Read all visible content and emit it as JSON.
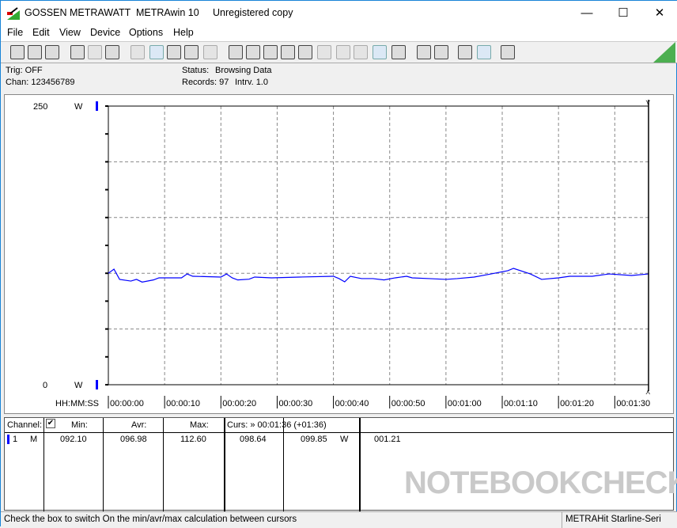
{
  "window": {
    "brand": "GOSSEN METRAWATT",
    "app": "METRAwin 10",
    "license": "Unregistered copy",
    "minimize": "—",
    "maximize": "☐",
    "close": "✕"
  },
  "menu": [
    "File",
    "Edit",
    "View",
    "Device",
    "Options",
    "Help"
  ],
  "toolbar_icons": [
    "save-icon",
    "save-as-icon",
    "open-folder-icon",
    "device-read-icon",
    "device-read-disabled-icon",
    "device-memory-icon",
    "digital-display-icon",
    "waveform-icon",
    "crosshair-icon",
    "table-icon",
    "histogram-icon",
    "transfer-icon",
    "import-icon",
    "data-log-icon",
    "monitor-icon",
    "function-icon",
    "device-icon",
    "signal-icon",
    "wave-icon",
    "trigger-icon",
    "cursor-icon",
    "print-icon",
    "print-preview-icon",
    "zoom-wave-icon",
    "zoom-active-icon",
    "comment-icon"
  ],
  "info": {
    "trig": "Trig: OFF",
    "chan": "Chan:  123456789",
    "status_label": "Status:",
    "status_value": "Browsing Data",
    "records": "Records: 97",
    "interval": "Intrv. 1.0"
  },
  "chart_data": {
    "type": "line",
    "ylim": [
      0,
      250
    ],
    "y_top_label": "250",
    "y_bottom_label": "0",
    "unit": "W",
    "xlabel": "HH:MM:SS",
    "xlim": [
      0,
      96
    ],
    "x_ticks": [
      "00:00:00",
      "00:00:10",
      "00:00:20",
      "00:00:30",
      "00:00:40",
      "00:00:50",
      "00:01:00",
      "00:01:10",
      "00:01:20",
      "00:01:30"
    ],
    "grid": true,
    "color": "#0000ff",
    "points": [
      [
        0,
        100.0
      ],
      [
        1,
        103.7
      ],
      [
        2,
        94.5
      ],
      [
        4,
        93.0
      ],
      [
        5,
        94.5
      ],
      [
        6,
        92.1
      ],
      [
        8,
        94.0
      ],
      [
        9,
        95.9
      ],
      [
        13,
        95.9
      ],
      [
        14,
        99.4
      ],
      [
        15,
        97.3
      ],
      [
        20,
        96.6
      ],
      [
        21,
        99.4
      ],
      [
        22,
        95.9
      ],
      [
        23,
        94.0
      ],
      [
        25,
        94.7
      ],
      [
        26,
        96.6
      ],
      [
        29,
        95.9
      ],
      [
        34,
        96.6
      ],
      [
        40,
        97.3
      ],
      [
        41,
        95.2
      ],
      [
        42,
        92.3
      ],
      [
        43,
        97.3
      ],
      [
        45,
        95.2
      ],
      [
        47,
        95.2
      ],
      [
        49,
        94.0
      ],
      [
        51,
        95.9
      ],
      [
        53,
        97.3
      ],
      [
        54,
        95.9
      ],
      [
        57,
        95.2
      ],
      [
        60,
        94.5
      ],
      [
        62,
        95.2
      ],
      [
        65,
        96.6
      ],
      [
        68,
        99.4
      ],
      [
        71,
        102.3
      ],
      [
        72,
        104.4
      ],
      [
        75,
        99.4
      ],
      [
        77,
        94.5
      ],
      [
        80,
        95.9
      ],
      [
        82,
        97.3
      ],
      [
        86,
        97.3
      ],
      [
        89,
        99.4
      ],
      [
        93,
        98.0
      ],
      [
        96,
        99.4
      ]
    ],
    "cursor_time": 96
  },
  "table": {
    "channel_h": "Channel:",
    "check": "✔",
    "min_h": "Min:",
    "avr_h": "Avr:",
    "max_h": "Max:",
    "curs_h": "Curs: » 00:01:36 (+01:36)",
    "row": {
      "ch": "1",
      "mode": "M",
      "min": "092.10",
      "avr": "096.98",
      "max": "112.60",
      "c1": "098.64",
      "c2": "099.85",
      "unit": "W",
      "c3": "001.21"
    }
  },
  "watermark": "NOTEBOOKCHECK",
  "status": {
    "hint": "Check the box to switch On the min/avr/max calculation between cursors",
    "device": "METRAHit Starline-Seri"
  }
}
